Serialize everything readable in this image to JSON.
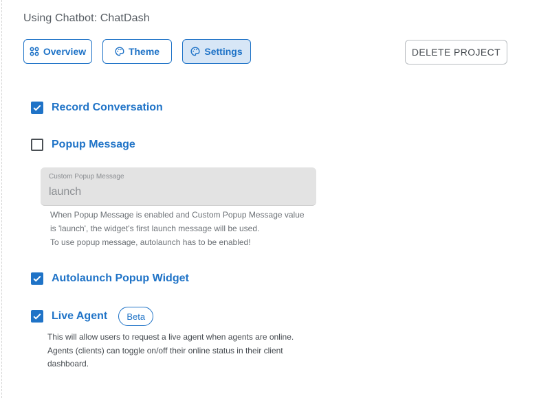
{
  "header": {
    "title": "Using Chatbot: ChatDash"
  },
  "nav": {
    "overview_label": "Overview",
    "theme_label": "Theme",
    "settings_label": "Settings",
    "active": "settings"
  },
  "actions": {
    "delete_label": "DELETE PROJECT"
  },
  "settings": {
    "record_conversation": {
      "label": "Record Conversation",
      "checked": true
    },
    "popup_message": {
      "label": "Popup Message",
      "checked": false,
      "custom_field": {
        "label": "Custom Popup Message",
        "value": "launch"
      },
      "helper_line1": "When Popup Message is enabled and Custom Popup Message value is 'launch', the widget's first launch message will be used.",
      "helper_line2": "To use popup message, autolaunch has to be enabled!"
    },
    "autolaunch": {
      "label": "Autolaunch Popup Widget",
      "checked": true
    },
    "live_agent": {
      "label": "Live Agent",
      "checked": true,
      "badge": "Beta",
      "description": "This will allow users to request a live agent when agents are online. Agents (clients) can toggle on/off their online status in their client dashboard."
    }
  },
  "colors": {
    "accent": "#1f73c7",
    "active_tab_bg": "#d7e6f6",
    "field_bg": "#e3e3e3"
  }
}
